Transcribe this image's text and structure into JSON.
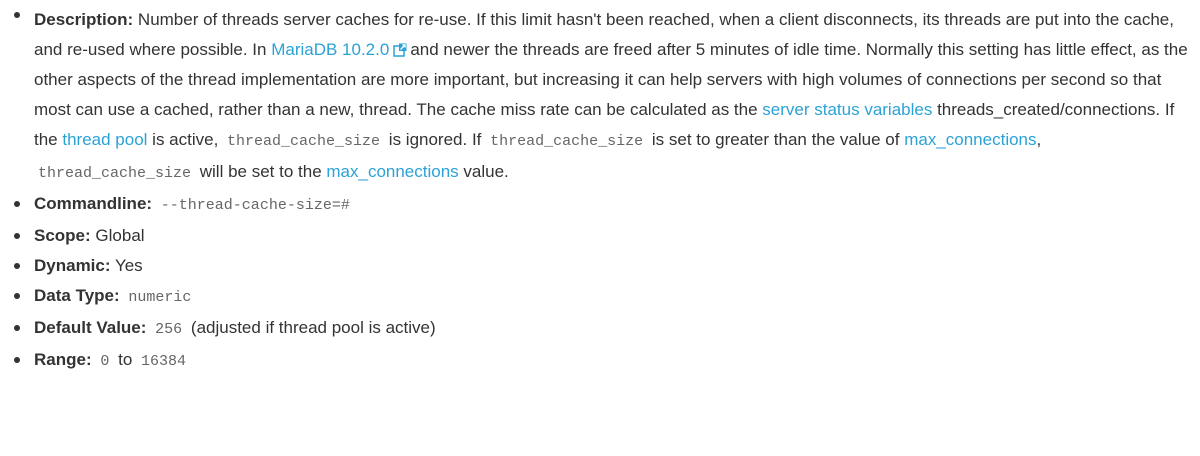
{
  "description": {
    "label": "Description:",
    "seg1": " Number of threads server caches for re-use. If this limit hasn't been reached, when a client disconnects, its threads are put into the cache, and re-used where possible. In ",
    "link_mariadb": "MariaDB 10.2.0",
    "seg2": "and newer the threads are freed after 5 minutes of idle time. Normally this setting has little effect, as the other aspects of the thread implementation are more important, but increasing it can help servers with high volumes of connections per second so that most can use a cached, rather than a new, thread. The cache miss rate can be calculated as the ",
    "link_status": "server status variables",
    "seg3": " threads_created/connections. If the ",
    "link_pool": "thread pool",
    "seg4": " is active, ",
    "code1": "thread_cache_size",
    "seg5": " is ignored. If ",
    "code2": "thread_cache_size",
    "seg6": " is set to greater than the value of ",
    "link_maxconn1": "max_connections",
    "seg7": ", ",
    "code3": "thread_cache_size",
    "seg8": " will be set to the ",
    "link_maxconn2": "max_connections",
    "seg9": " value."
  },
  "commandline": {
    "label": "Commandline:",
    "value": "--thread-cache-size=#"
  },
  "scope": {
    "label": "Scope:",
    "value": " Global"
  },
  "dynamic": {
    "label": "Dynamic:",
    "value": " Yes"
  },
  "data_type": {
    "label": "Data Type:",
    "value": "numeric"
  },
  "default_value": {
    "label": "Default Value:",
    "value": "256",
    "note": "(adjusted if thread pool is active)"
  },
  "range": {
    "label": "Range:",
    "min": "0",
    "to": "to",
    "max": "16384"
  },
  "colors": {
    "link": "#2ba2d6",
    "text": "#333333",
    "code": "#666666"
  },
  "icons": {
    "external": "external-link-icon"
  }
}
